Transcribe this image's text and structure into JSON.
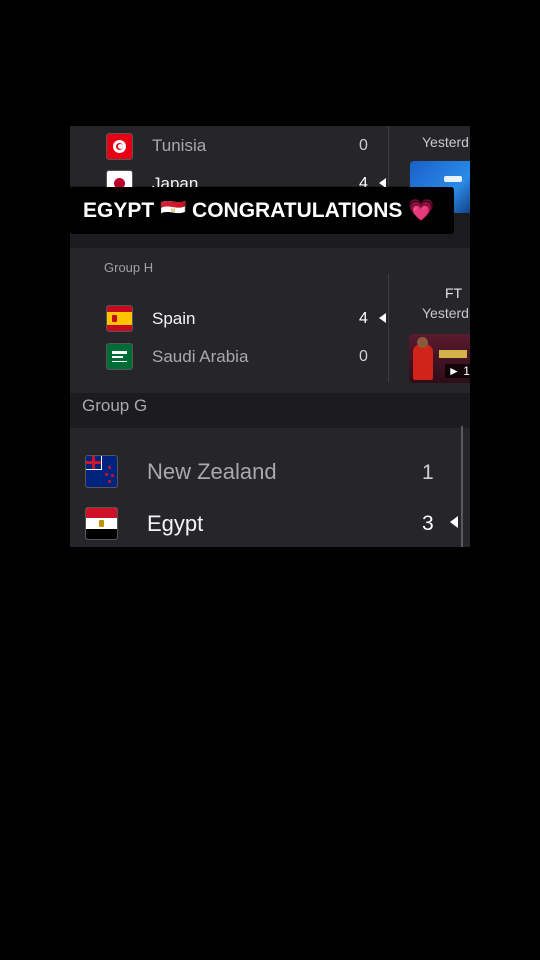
{
  "group_top": {
    "teams": [
      {
        "name": "Tunisia",
        "score": "0"
      },
      {
        "name": "Japan",
        "score": "4"
      }
    ],
    "date": "Yesterd"
  },
  "caption": {
    "text": "EGYPT",
    "text2": "CONGRATULATIONS",
    "flag_emoji": "🇪🇬",
    "heart": "💗"
  },
  "group_h": {
    "label": "Group H",
    "status": "FT",
    "date": "Yesterd",
    "thumb_label": "► 1:",
    "teams": [
      {
        "name": "Spain",
        "score": "4",
        "winner": true
      },
      {
        "name": "Saudi Arabia",
        "score": "0",
        "winner": false
      }
    ]
  },
  "group_g": {
    "label": "Group G",
    "teams": [
      {
        "name": "New Zealand",
        "score": "1",
        "winner": false
      },
      {
        "name": "Egypt",
        "score": "3",
        "winner": true
      }
    ]
  },
  "colors": {
    "background": "#000000",
    "panel": "#1c1c1e",
    "card": "#26262a",
    "tunisia_red": "#e70013",
    "spain_red": "#c60b1e",
    "spain_yellow": "#ffc400",
    "saudi_green": "#006c35",
    "nz_blue": "#00247d",
    "egypt_red": "#ce1126"
  }
}
